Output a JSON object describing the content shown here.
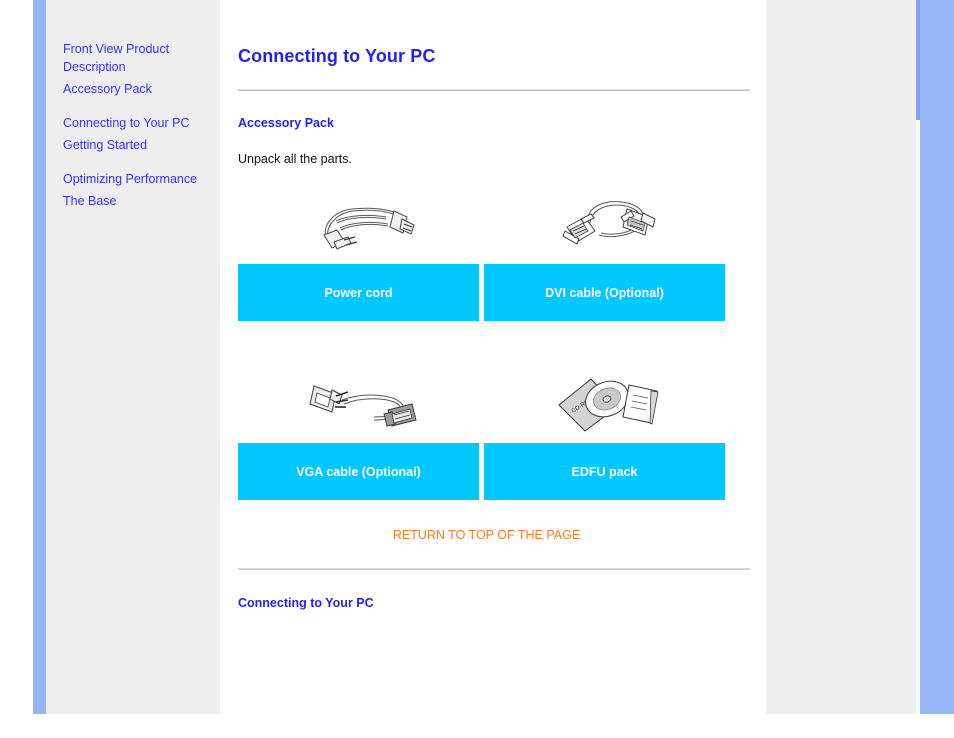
{
  "sidebar": {
    "groups": [
      {
        "items": [
          {
            "label": "Front View Product Description",
            "name": "front-view-product-description"
          },
          {
            "label": "Accessory Pack",
            "name": "accessory-pack"
          }
        ]
      },
      {
        "items": [
          {
            "label": "Connecting to Your PC",
            "name": "connecting-to-your-pc"
          },
          {
            "label": "Getting Started",
            "name": "getting-started"
          }
        ]
      },
      {
        "items": [
          {
            "label": "Optimizing Performance",
            "name": "optimizing-performance"
          },
          {
            "label": "The Base",
            "name": "the-base"
          }
        ]
      }
    ]
  },
  "main": {
    "title": "Connecting to Your PC",
    "section_heading": "Accessory Pack",
    "body_text": "Unpack all the parts.",
    "products": [
      {
        "caption": "Power cord",
        "icon": "power-cord-illustration"
      },
      {
        "caption": "DVI cable (Optional)",
        "icon": "dvi-cable-illustration"
      },
      {
        "caption": "VGA cable (Optional)",
        "icon": "vga-cable-illustration"
      },
      {
        "caption": "EDFU pack",
        "icon": "edfu-pack-illustration"
      }
    ],
    "return_link": "RETURN TO TOP OF THE PAGE",
    "bottom_heading": "Connecting to Your PC"
  },
  "colors": {
    "link_blue": "#3333ff",
    "heading_blue": "#2222ee",
    "caption_cyan": "#00c8ff",
    "return_orange": "#ff7722",
    "band_blue": "#94b4f4",
    "panel_gray": "#eeeeee"
  }
}
